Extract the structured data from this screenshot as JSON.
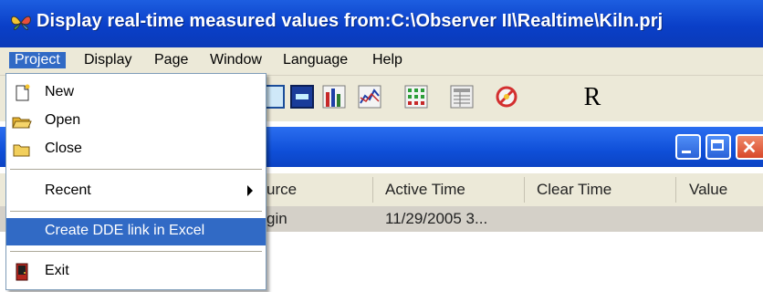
{
  "window": {
    "title": "Display real-time measured values from:C:\\Observer II\\Realtime\\Kiln.prj",
    "icon": "butterfly-app-icon"
  },
  "menubar": {
    "items": [
      {
        "label": "Project",
        "active": true
      },
      {
        "label": "Display"
      },
      {
        "label": "Page"
      },
      {
        "label": "Window"
      },
      {
        "label": "Language"
      },
      {
        "label": "Help"
      }
    ]
  },
  "toolbar": {
    "r_label": "R",
    "icons": [
      "window-icon",
      "numeric-display-icon",
      "bar-chart-icon",
      "line-chart-icon",
      "grid-icon",
      "table-icon",
      "alarm-icon"
    ]
  },
  "project_menu": {
    "items": [
      {
        "label": "New",
        "icon": "new-file-icon"
      },
      {
        "label": "Open",
        "icon": "open-folder-icon"
      },
      {
        "label": "Close",
        "icon": "close-folder-icon"
      },
      {
        "label": "Recent",
        "submenu": true
      },
      {
        "label": "Create DDE link in Excel",
        "selected": true
      },
      {
        "label": "Exit",
        "icon": "exit-icon"
      }
    ]
  },
  "grid": {
    "headers": [
      "urce",
      "Active Time",
      "Clear Time",
      "Value"
    ],
    "rows": [
      [
        "gin",
        "11/29/2005 3...",
        "",
        ""
      ]
    ]
  },
  "colors": {
    "title_blue": "#0a3fc8",
    "menu_bg": "#ece9d8",
    "selection": "#316ac5",
    "close_button": "#e2542c"
  }
}
